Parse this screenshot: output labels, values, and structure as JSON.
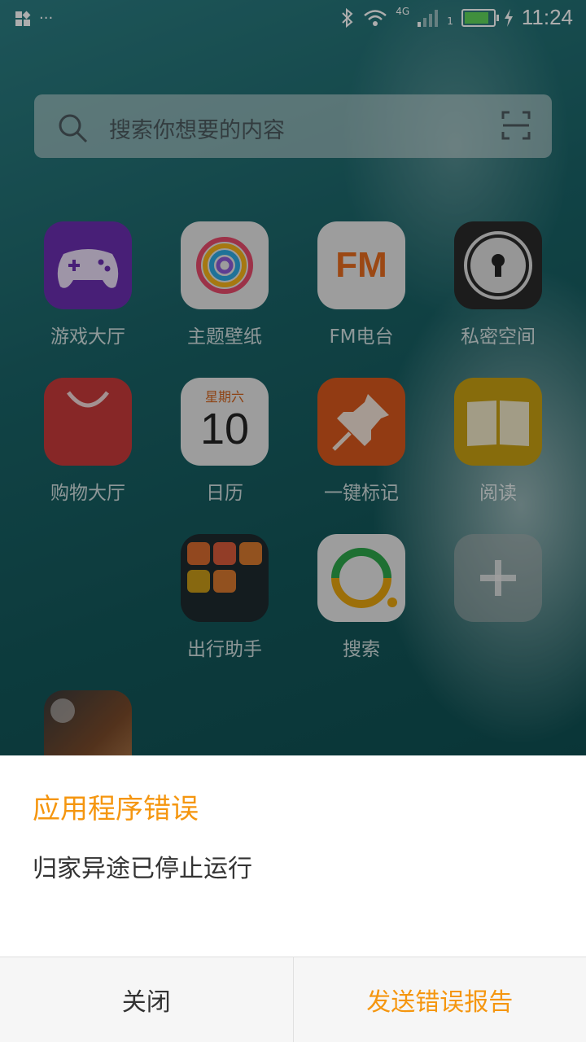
{
  "status_bar": {
    "network_label": "4G",
    "signal_sub": "1",
    "time": "11:24",
    "battery_fraction": 0.85
  },
  "search": {
    "placeholder": "搜索你想要的内容"
  },
  "apps": [
    {
      "label": "游戏大厅"
    },
    {
      "label": "主题壁纸"
    },
    {
      "label": "FM电台",
      "icon_text": "FM"
    },
    {
      "label": "私密空间"
    },
    {
      "label": "购物大厅"
    },
    {
      "label": "日历",
      "weekday": "星期六",
      "day": "10"
    },
    {
      "label": "一键标记"
    },
    {
      "label": "阅读"
    },
    {
      "label": "出行助手"
    },
    {
      "label": "搜索"
    }
  ],
  "dialog": {
    "title": "应用程序错误",
    "message": "归家异途已停止运行",
    "close_label": "关闭",
    "send_label": "发送错误报告"
  },
  "colors": {
    "accent": "#f5960f"
  }
}
